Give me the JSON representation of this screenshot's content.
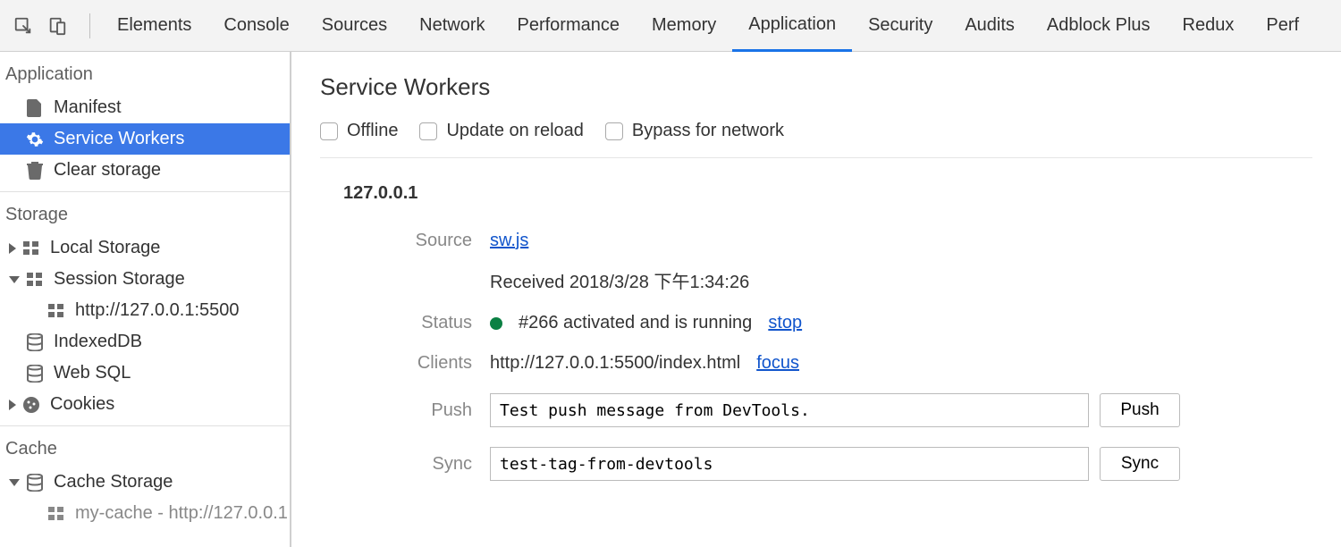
{
  "tabs": [
    "Elements",
    "Console",
    "Sources",
    "Network",
    "Performance",
    "Memory",
    "Application",
    "Security",
    "Audits",
    "Adblock Plus",
    "Redux",
    "Perf"
  ],
  "active_tab": "Application",
  "sidebar": {
    "sections": {
      "application": {
        "title": "Application",
        "items": [
          {
            "label": "Manifest",
            "icon": "file-icon"
          },
          {
            "label": "Service Workers",
            "icon": "gear-icon",
            "selected": true
          },
          {
            "label": "Clear storage",
            "icon": "trash-icon"
          }
        ]
      },
      "storage": {
        "title": "Storage",
        "items": [
          {
            "label": "Local Storage",
            "icon": "grid-icon",
            "disclosure": "closed"
          },
          {
            "label": "Session Storage",
            "icon": "grid-icon",
            "disclosure": "open",
            "children": [
              {
                "label": "http://127.0.0.1:5500",
                "icon": "grid-icon"
              }
            ]
          },
          {
            "label": "IndexedDB",
            "icon": "database-icon"
          },
          {
            "label": "Web SQL",
            "icon": "database-icon"
          },
          {
            "label": "Cookies",
            "icon": "cookie-icon",
            "disclosure": "closed"
          }
        ]
      },
      "cache": {
        "title": "Cache",
        "items": [
          {
            "label": "Cache Storage",
            "icon": "database-icon",
            "disclosure": "open",
            "children": [
              {
                "label": "my-cache - http://127.0.0.1",
                "icon": "grid-icon"
              }
            ]
          }
        ]
      }
    }
  },
  "content": {
    "title": "Service Workers",
    "options": [
      {
        "label": "Offline",
        "checked": false
      },
      {
        "label": "Update on reload",
        "checked": false
      },
      {
        "label": "Bypass for network",
        "checked": false
      }
    ],
    "origin": "127.0.0.1",
    "source": {
      "label": "Source",
      "link": "sw.js",
      "received": "Received 2018/3/28 下午1:34:26"
    },
    "status": {
      "label": "Status",
      "text": "#266 activated and is running",
      "action": "stop"
    },
    "clients": {
      "label": "Clients",
      "url": "http://127.0.0.1:5500/index.html",
      "action": "focus"
    },
    "push": {
      "label": "Push",
      "value": "Test push message from DevTools.",
      "button": "Push"
    },
    "sync": {
      "label": "Sync",
      "value": "test-tag-from-devtools",
      "button": "Sync"
    }
  }
}
